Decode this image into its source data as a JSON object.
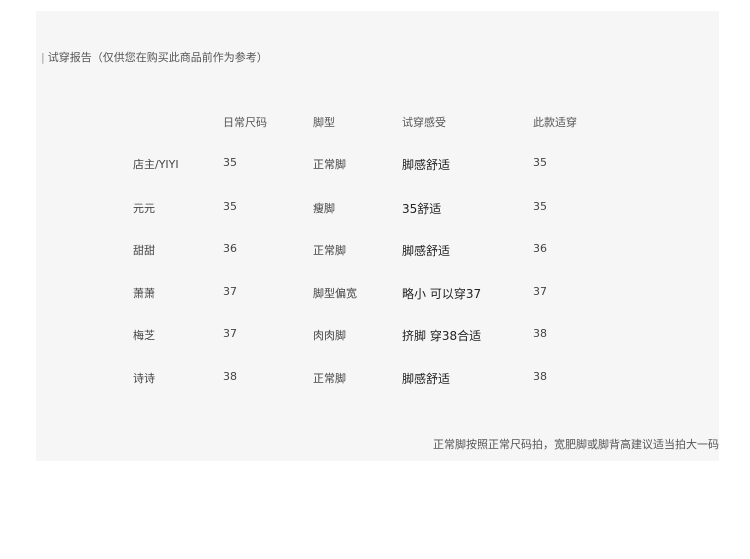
{
  "section_title": "试穿报告（仅供您在购买此商品前作为参考）",
  "table": {
    "headers": [
      "日常尺码",
      "脚型",
      "试穿感受",
      "此款适穿"
    ],
    "rows": [
      {
        "name": "店主/YIYI",
        "size": "35",
        "foot": "正常脚",
        "feel": "脚感舒适",
        "fit": "35"
      },
      {
        "name": "元元",
        "size": "35",
        "foot": "瘦脚",
        "feel": "35舒适",
        "fit": "35"
      },
      {
        "name": "甜甜",
        "size": "36",
        "foot": "正常脚",
        "feel": "脚感舒适",
        "fit": "36"
      },
      {
        "name": "萧萧",
        "size": "37",
        "foot": "脚型偏宽",
        "feel": "略小 可以穿37",
        "fit": "37"
      },
      {
        "name": "梅芝",
        "size": "37",
        "foot": "肉肉脚",
        "feel": "挤脚 穿38合适",
        "fit": "38"
      },
      {
        "name": "诗诗",
        "size": "38",
        "foot": "正常脚",
        "feel": "脚感舒适",
        "fit": "38"
      }
    ]
  },
  "footer_note": "正常脚按照正常尺码拍，宽肥脚或脚背高建议适当拍大一码"
}
